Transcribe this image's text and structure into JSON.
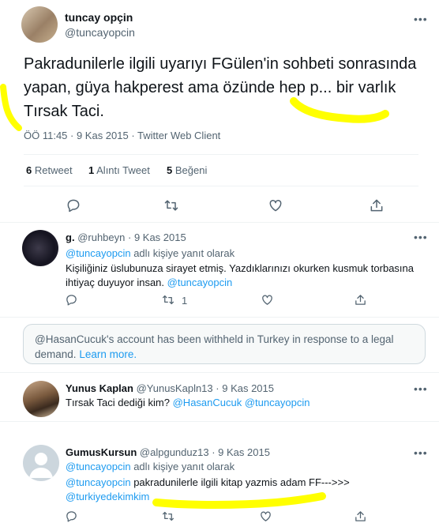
{
  "main_tweet": {
    "display_name": "tuncay opçin",
    "handle": "@tuncayopcin",
    "text_line1": "Pakradunilerle ilgili uyarıyı FGülen'in sohbeti sonrasında",
    "text_line2": "yapan, güya hakperest ama özünde hep p... bir varlık",
    "text_line3": "Tırsak Taci.",
    "meta": "ÖÖ 11:45 · 9 Kas 2015 · Twitter Web Client",
    "retweet_count": "6",
    "retweet_label": "Retweet",
    "quote_count": "1",
    "quote_label": "Alıntı Tweet",
    "like_count": "5",
    "like_label": "Beğeni"
  },
  "replies": [
    {
      "display_name": "g.",
      "handle": "@ruhbeyn",
      "date": "· 9 Kas 2015",
      "reply_to_mention": "@tuncayopcin",
      "reply_to_suffix": "adlı kişiye yanıt olarak",
      "text_line1": "Kişiliğiniz üslubunuza sirayet etmiş. Yazdıklarınızı okurken kusmuk torbasına",
      "text_line2": "ihtiyaç duyuyor insan.",
      "text_mention": "@tuncayopcin",
      "retweet_count": "1"
    },
    {
      "display_name": "Yunus Kaplan",
      "handle": "@YunusKapln13",
      "date": "· 9 Kas 2015",
      "text": "Tırsak Taci dediği kim?",
      "mention1": "@HasanCucuk",
      "mention2": "@tuncayopcin"
    },
    {
      "display_name": "GumusKursun",
      "handle": "@alpgunduz13",
      "date": "· 9 Kas 2015",
      "reply_to_mention": "@tuncayopcin",
      "reply_to_suffix": "adlı kişiye yanıt olarak",
      "text_mention": "@tuncayopcin",
      "text": "pakradunilerle ilgili kitap yazmis adam FF--->>>",
      "text_mention2": "@turkiyedekimkim"
    }
  ],
  "withheld_notice": {
    "text_line1": "@HasanCucuk's account has been withheld in Turkey in response to a legal",
    "text_line2": "demand.",
    "learn_more": "Learn more."
  },
  "more_glyph": "•••",
  "colors": {
    "link": "#1d9bf0",
    "muted": "#536471",
    "highlight": "#ffff00",
    "divider": "#eff3f4"
  }
}
